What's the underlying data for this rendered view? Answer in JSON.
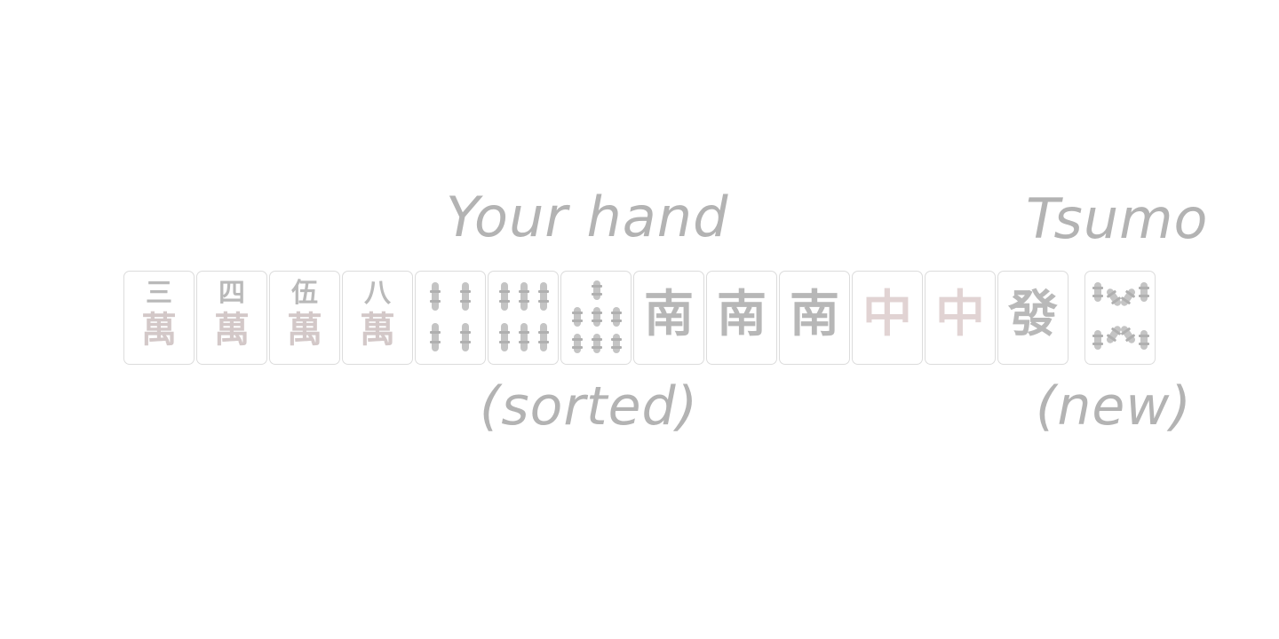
{
  "labels": {
    "hand_title": "Your hand",
    "hand_subtitle": "(sorted)",
    "tsumo_title": "Tsumo",
    "tsumo_subtitle": "(new)"
  },
  "hand": [
    {
      "suit": "man",
      "rank": 3,
      "top": "三",
      "bottom": "萬"
    },
    {
      "suit": "man",
      "rank": 4,
      "top": "四",
      "bottom": "萬"
    },
    {
      "suit": "man",
      "rank": 5,
      "top": "伍",
      "bottom": "萬"
    },
    {
      "suit": "man",
      "rank": 8,
      "top": "八",
      "bottom": "萬"
    },
    {
      "suit": "sou",
      "rank": 4
    },
    {
      "suit": "sou",
      "rank": 6
    },
    {
      "suit": "sou",
      "rank": 7
    },
    {
      "suit": "honor",
      "name": "south",
      "glyph": "南"
    },
    {
      "suit": "honor",
      "name": "south",
      "glyph": "南"
    },
    {
      "suit": "honor",
      "name": "south",
      "glyph": "南"
    },
    {
      "suit": "honor",
      "name": "red-dragon",
      "glyph": "中"
    },
    {
      "suit": "honor",
      "name": "red-dragon",
      "glyph": "中"
    },
    {
      "suit": "honor",
      "name": "green-dragon",
      "glyph": "發"
    }
  ],
  "tsumo": {
    "suit": "sou",
    "rank": 8
  },
  "colors": {
    "label": "#b3b3b3",
    "tile_border": "#dcdcdc",
    "red_dragon": "#e1d3d3",
    "ink": "#b9b9b9"
  }
}
